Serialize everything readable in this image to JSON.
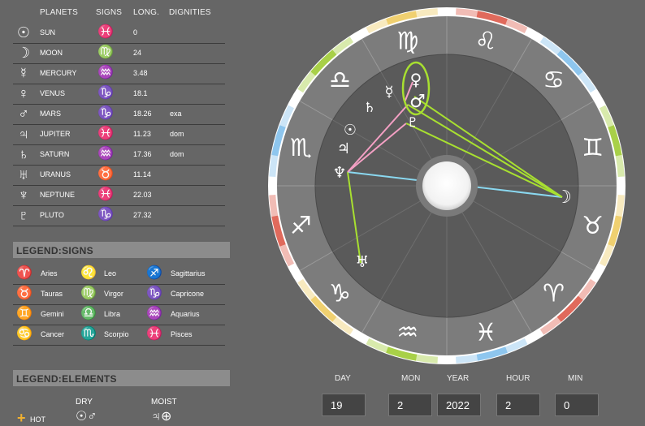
{
  "colors": {
    "background": "#666666",
    "fire": "#e06a5c",
    "earth": "#f0d070",
    "air": "#a8d048",
    "water": "#8ec6ee",
    "aspect_green": "#a8e030",
    "aspect_pink": "#f4a0c4",
    "aspect_blue": "#8ad8f0"
  },
  "planets_table": {
    "headers": {
      "planets": "PLANETS",
      "signs": "SIGNS",
      "long": "LONG.",
      "dignities": "DIGNITIES"
    },
    "rows": [
      {
        "glyph": "☉",
        "name": "SUN",
        "sign": "♓",
        "sign_color": "#8ec6ee",
        "long": "0",
        "dignity": ""
      },
      {
        "glyph": "☽",
        "name": "MOON",
        "sign": "♍",
        "sign_color": "#f0d070",
        "long": "24",
        "dignity": ""
      },
      {
        "glyph": "☿",
        "name": "MERCURY",
        "sign": "♒",
        "sign_color": "#a8d048",
        "long": "3.48",
        "dignity": ""
      },
      {
        "glyph": "♀",
        "name": "VENUS",
        "sign": "♑",
        "sign_color": "#f0d070",
        "long": "18.1",
        "dignity": ""
      },
      {
        "glyph": "♂",
        "name": "MARS",
        "sign": "♑",
        "sign_color": "#f0d070",
        "long": "18.26",
        "dignity": "exa"
      },
      {
        "glyph": "♃",
        "name": "JUPITER",
        "sign": "♓",
        "sign_color": "#8ec6ee",
        "long": "11.23",
        "dignity": "dom"
      },
      {
        "glyph": "♄",
        "name": "SATURN",
        "sign": "♒",
        "sign_color": "#a8d048",
        "long": "17.36",
        "dignity": "dom"
      },
      {
        "glyph": "♅",
        "name": "URANUS",
        "sign": "♉",
        "sign_color": "#f0d070",
        "long": "11.14",
        "dignity": ""
      },
      {
        "glyph": "♆",
        "name": "NEPTUNE",
        "sign": "♓",
        "sign_color": "#8ec6ee",
        "long": "22.03",
        "dignity": ""
      },
      {
        "glyph": "♇",
        "name": "PLUTO",
        "sign": "♑",
        "sign_color": "#f0d070",
        "long": "27.32",
        "dignity": ""
      }
    ]
  },
  "legend_signs": {
    "title": "LEGEND:SIGNS",
    "rows": [
      [
        {
          "glyph": "♈",
          "label": "Aries",
          "color": "#e06a5c"
        },
        {
          "glyph": "♌",
          "label": "Leo",
          "color": "#e06a5c"
        },
        {
          "glyph": "♐",
          "label": "Sagittarius",
          "color": "#e06a5c"
        }
      ],
      [
        {
          "glyph": "♉",
          "label": "Tauras",
          "color": "#f0d070"
        },
        {
          "glyph": "♍",
          "label": "Virgor",
          "color": "#f0d070"
        },
        {
          "glyph": "♑",
          "label": "Capricone",
          "color": "#f0d070"
        }
      ],
      [
        {
          "glyph": "♊",
          "label": "Gemini",
          "color": "#a8d048"
        },
        {
          "glyph": "♎",
          "label": "Libra",
          "color": "#a8d048"
        },
        {
          "glyph": "♒",
          "label": "Aquarius",
          "color": "#a8d048"
        }
      ],
      [
        {
          "glyph": "♋",
          "label": "Cancer",
          "color": "#8ec6ee"
        },
        {
          "glyph": "♏",
          "label": "Scorpio",
          "color": "#8ec6ee"
        },
        {
          "glyph": "♓",
          "label": "Pisces",
          "color": "#8ec6ee"
        }
      ]
    ]
  },
  "legend_elements": {
    "title": "LEGEND:ELEMENTS",
    "dry": "DRY",
    "moist": "MOIST",
    "hot": "HOT",
    "hot_icon": "+",
    "hot_dry_glyphs": "☉♂",
    "hot_moist_glyphs": "♃⊕"
  },
  "date_inputs": [
    {
      "label": "DAY",
      "value": "19"
    },
    {
      "label": "MON",
      "value": "2"
    },
    {
      "label": "YEAR",
      "value": "2022"
    },
    {
      "label": "HOUR",
      "value": "2"
    },
    {
      "label": "MIN",
      "value": "0"
    }
  ],
  "wheel": {
    "signs_ccw_from_left": [
      "♐",
      "♑",
      "♒",
      "♓",
      "♈",
      "♉",
      "♊",
      "♋",
      "♌",
      "♍",
      "♎",
      "♏"
    ],
    "planet_glyphs": {
      "moon": "☽",
      "venus": "♀",
      "mercury": "☿",
      "mars": "♂",
      "pluto": "♇",
      "saturn": "♄",
      "sun": "☉",
      "jupiter": "♃",
      "neptune": "♆",
      "uranus": "♅"
    }
  }
}
